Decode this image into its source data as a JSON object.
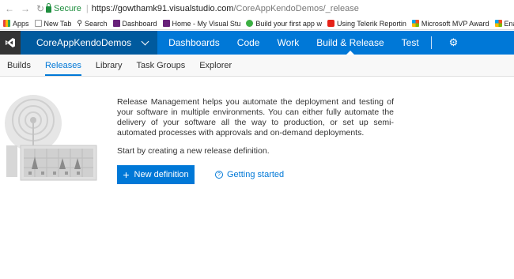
{
  "browser": {
    "secure_label": "Secure",
    "url_host": "https://gowthamk91.visualstudio.com",
    "url_path": "/CoreAppKendoDemos/_release"
  },
  "bookmarks": [
    {
      "label": "Apps",
      "icon": "apps-grid-icon",
      "color": "#e8453c"
    },
    {
      "label": "New Tab",
      "icon": "page-icon",
      "color": "#bbbbbb"
    },
    {
      "label": "Search",
      "icon": "search-icon",
      "color": "#555555"
    },
    {
      "label": "Dashboard",
      "icon": "vsts-icon",
      "color": "#68217a"
    },
    {
      "label": "Home - My Visual Stu",
      "icon": "vs-icon",
      "color": "#68217a"
    },
    {
      "label": "Build your first app w",
      "icon": "xamarin-icon",
      "color": "#3cb043"
    },
    {
      "label": "Using Telerik Reportin",
      "icon": "youtube-icon",
      "color": "#e62117"
    },
    {
      "label": "Microsoft MVP Award",
      "icon": "microsoft-icon",
      "color": "#f25022"
    },
    {
      "label": "Enabling Cro",
      "icon": "microsoft-icon",
      "color": "#f25022"
    }
  ],
  "topbar": {
    "project": "CoreAppKendoDemos",
    "nav": [
      "Dashboards",
      "Code",
      "Work",
      "Build & Release",
      "Test"
    ],
    "active_nav": "Build & Release",
    "accent": "#0078d7"
  },
  "subnav": {
    "tabs": [
      "Builds",
      "Releases",
      "Library",
      "Task Groups",
      "Explorer"
    ],
    "active": "Releases"
  },
  "main": {
    "description": "Release Management helps you automate the deployment and testing of your software in multiple environments. You can either fully automate the delivery of your software all the way to production, or set up semi-automated processes with approvals and on-demand deployments.",
    "start_text": "Start by creating a new release definition.",
    "new_definition_label": "New definition",
    "getting_started_label": "Getting started"
  }
}
